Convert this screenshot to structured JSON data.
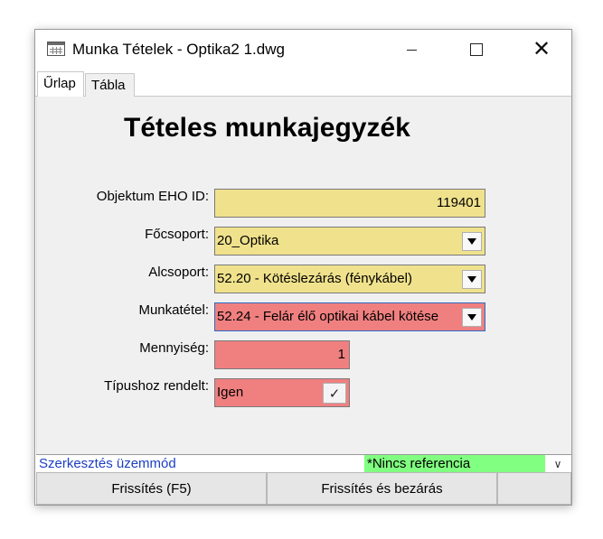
{
  "window": {
    "title": "Munka Tételek - Optika2 1.dwg",
    "controls": {
      "minimize": "minimize",
      "maximize": "maximize",
      "close": "✕"
    }
  },
  "tabs": [
    {
      "label": "Űrlap",
      "active": true
    },
    {
      "label": "Tábla",
      "active": false
    }
  ],
  "form": {
    "heading": "Tételes munkajegyzék",
    "fields": {
      "objektum": {
        "label": "Objektum EHO ID:",
        "value": "119401"
      },
      "focsoport": {
        "label": "Főcsoport:",
        "value": "20_Optika"
      },
      "alcsoport": {
        "label": "Alcsoport:",
        "value": "52.20 - Kötéslezárás (fénykábel)"
      },
      "munkatetel": {
        "label": "Munkatétel:",
        "value": "52.24 - Felár élő optikai kábel kötése"
      },
      "mennyiseg": {
        "label": "Mennyiség:",
        "value": "1"
      },
      "tipushoz": {
        "label": "Típushoz rendelt:",
        "value": "Igen",
        "check_glyph": "✓"
      }
    }
  },
  "status": {
    "mode": "Szerkesztés üzemmód",
    "reference": "*Nincs referencia",
    "dropdown_glyph": "∨"
  },
  "buttons": {
    "refresh": "Frissítés (F5)",
    "refresh_close": "Frissítés és bezárás",
    "extra": ""
  },
  "colors": {
    "required_yellow": "#f0e28c",
    "invalid_red": "#f08080",
    "reference_green": "#80ff80",
    "status_blue": "#1b3ec4"
  }
}
